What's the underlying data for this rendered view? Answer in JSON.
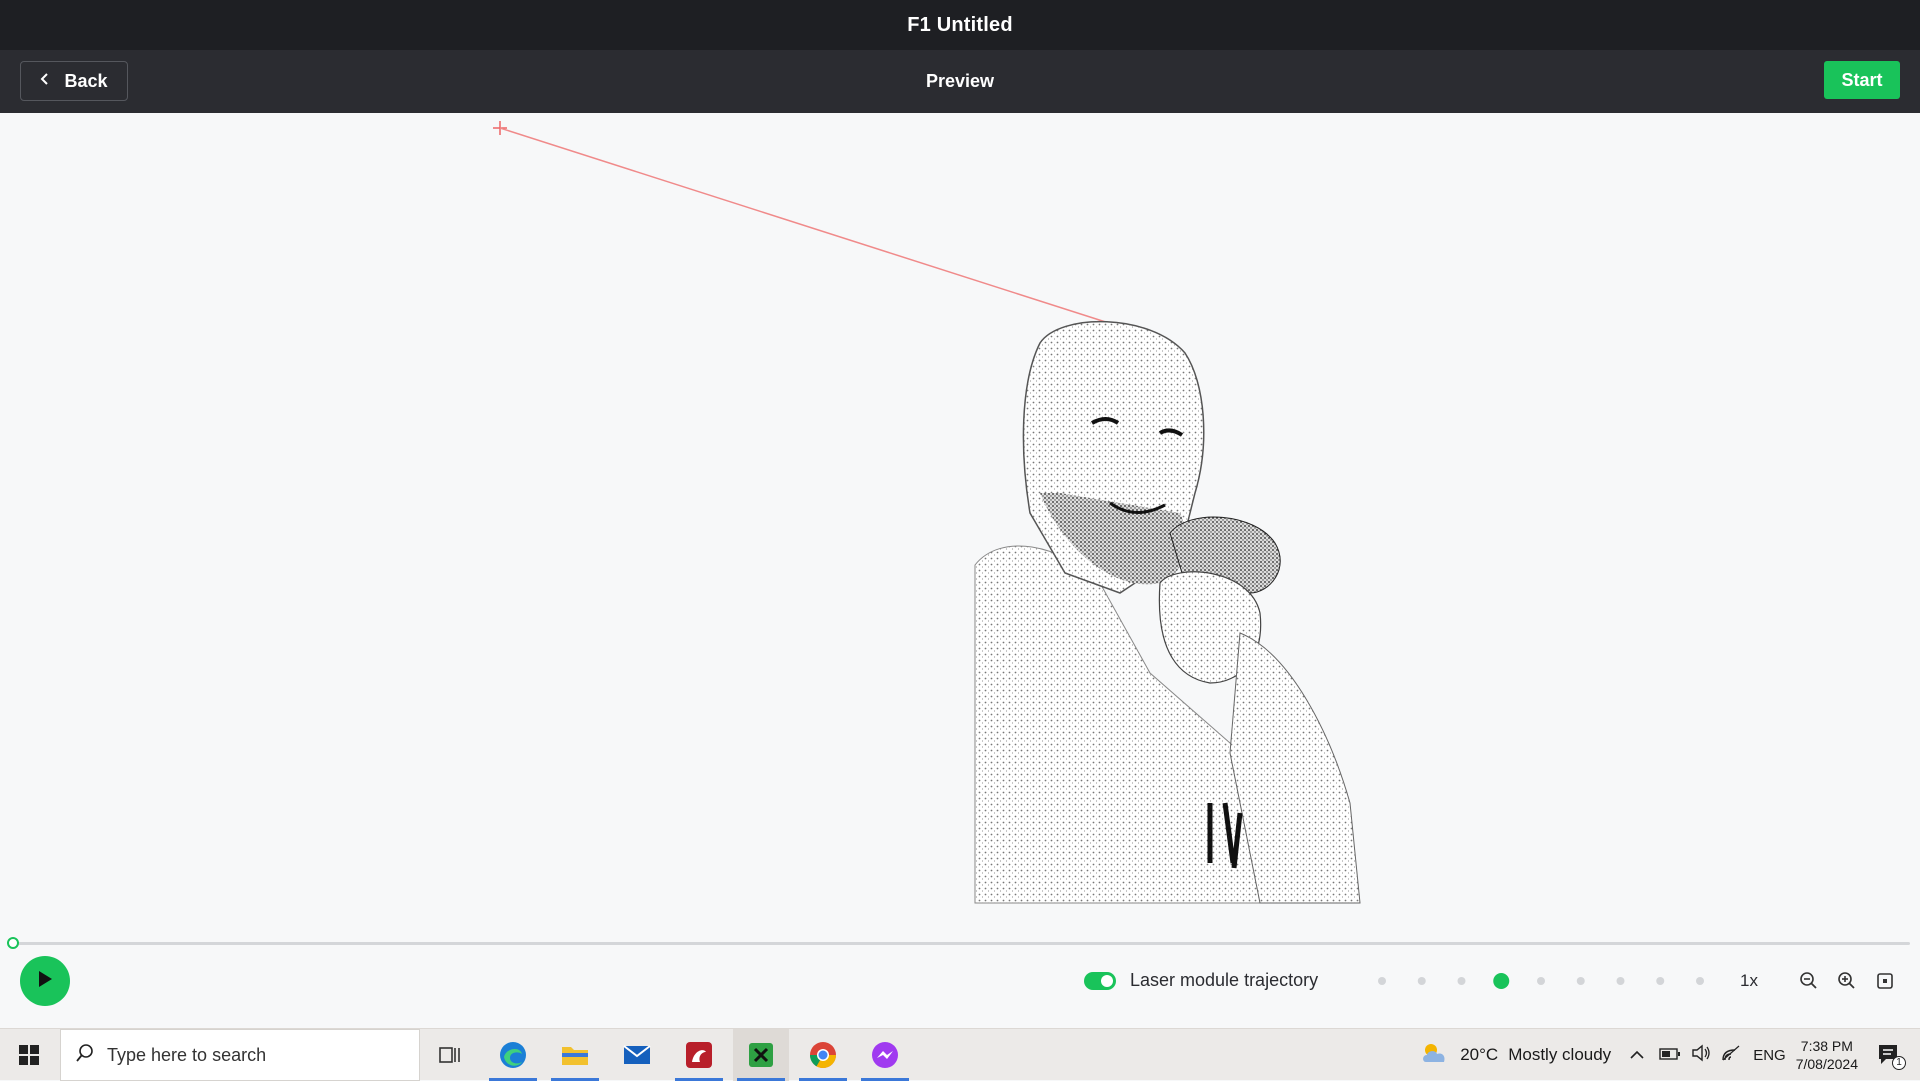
{
  "window": {
    "title": "F1 Untitled"
  },
  "toolbar": {
    "back_label": "Back",
    "page_title": "Preview",
    "start_label": "Start"
  },
  "canvas": {
    "trajectory_color": "#f08a8a"
  },
  "playback": {
    "progress": 0.0,
    "toggle_label": "Laser module trajectory",
    "toggle_on": true,
    "speed_steps": 9,
    "speed_selected_index": 3,
    "speed_text": "1x"
  },
  "taskbar": {
    "search_placeholder": "Type here to search",
    "apps": [
      "task-view-icon",
      "edge-icon",
      "file-explorer-icon",
      "mail-icon",
      "app-red-icon",
      "xbox-icon",
      "chrome-icon",
      "messenger-icon"
    ],
    "weather_temp": "20°C",
    "weather_text": "Mostly cloudy",
    "language": "ENG",
    "time": "7:38 PM",
    "date": "7/08/2024",
    "notification_count": "1"
  },
  "colors": {
    "accent": "#19c35a",
    "titlebar": "#1e1f23",
    "toolbar": "#2b2c31"
  }
}
